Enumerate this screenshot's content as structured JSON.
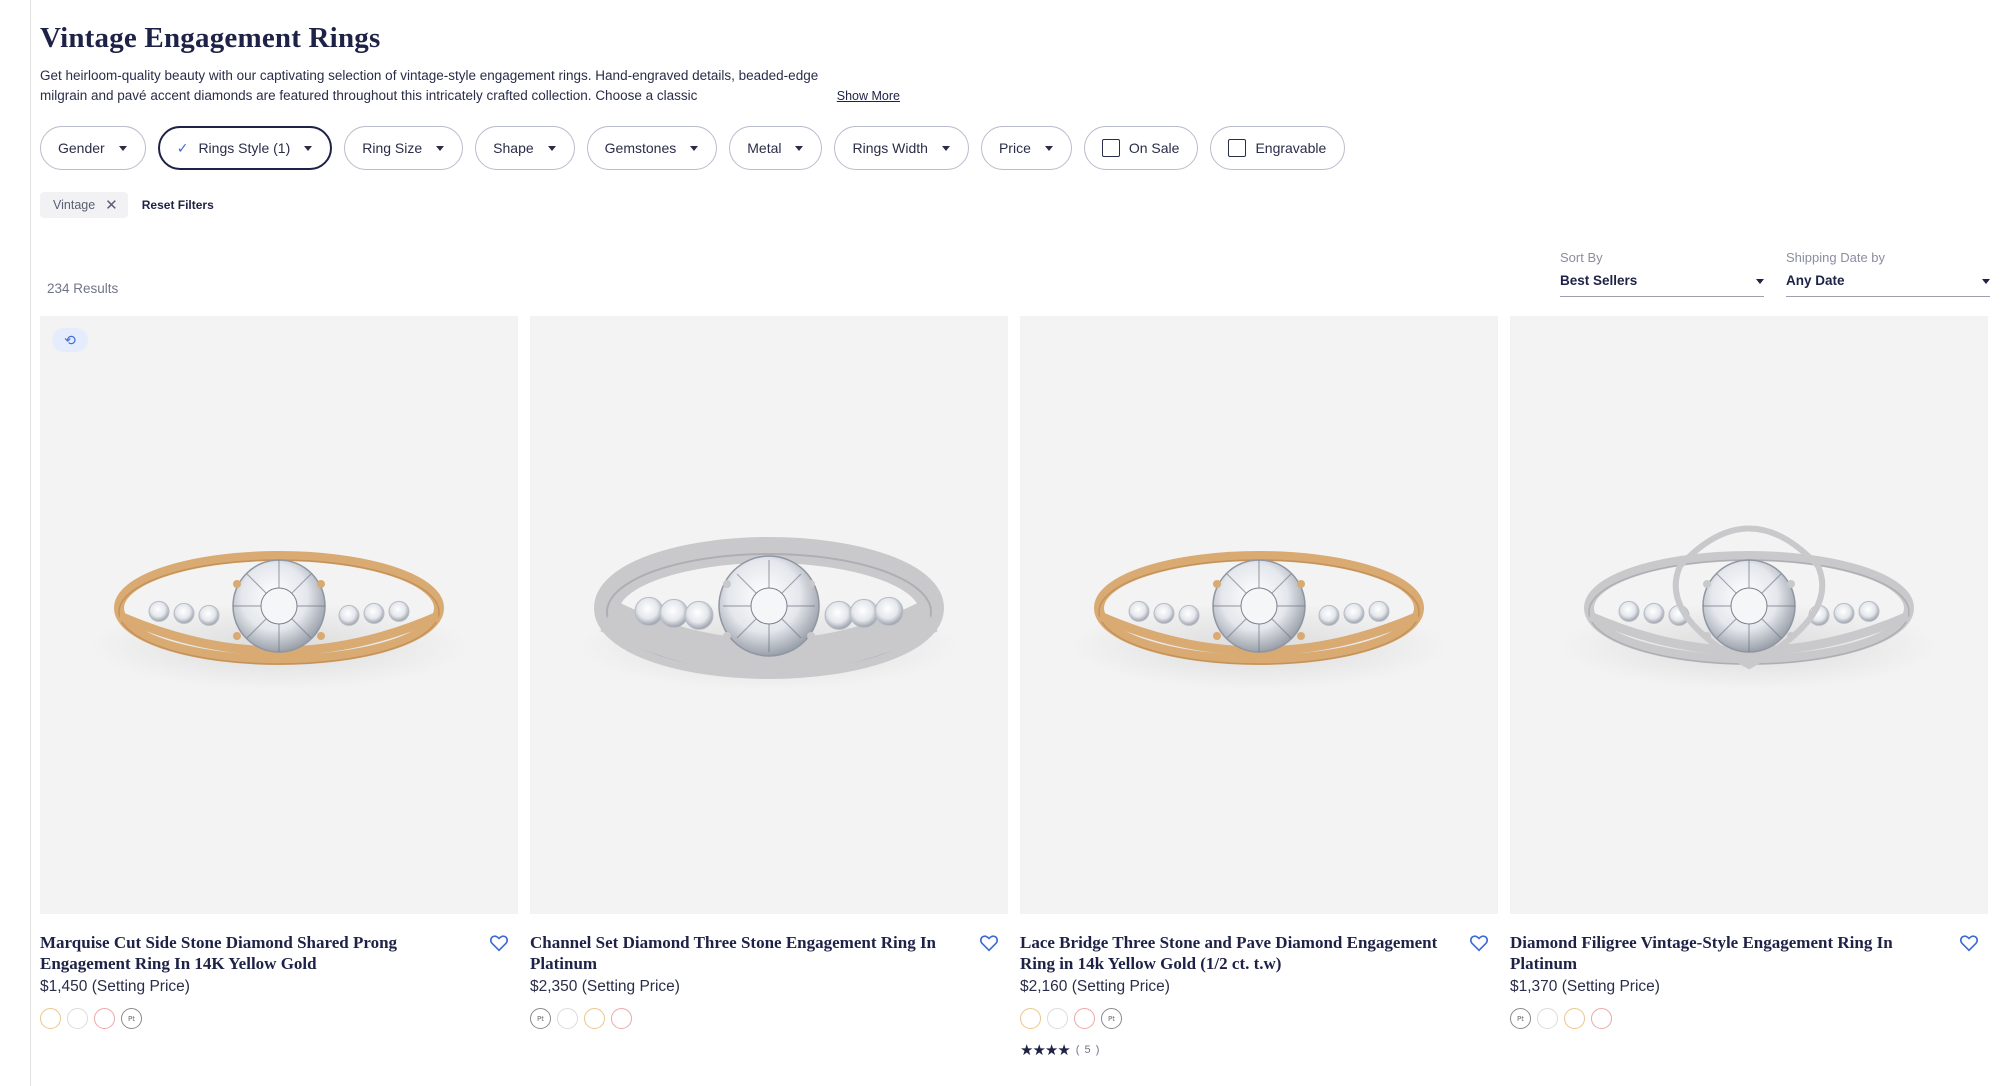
{
  "page": {
    "title": "Vintage Engagement Rings",
    "description": "Get heirloom-quality beauty with our captivating selection of vintage-style engagement rings. Hand-engraved details, beaded-edge milgrain and pavé accent diamonds are featured throughout this intricately crafted collection. Choose a classic",
    "show_more": "Show More"
  },
  "filters": [
    {
      "label": "Gender",
      "type": "dropdown"
    },
    {
      "label": "Rings Style (1)",
      "type": "dropdown-active"
    },
    {
      "label": "Ring Size",
      "type": "dropdown"
    },
    {
      "label": "Shape",
      "type": "dropdown"
    },
    {
      "label": "Gemstones",
      "type": "dropdown"
    },
    {
      "label": "Metal",
      "type": "dropdown"
    },
    {
      "label": "Rings Width",
      "type": "dropdown"
    },
    {
      "label": "Price",
      "type": "dropdown"
    },
    {
      "label": "On Sale",
      "type": "checkbox"
    },
    {
      "label": "Engravable",
      "type": "checkbox"
    }
  ],
  "applied": {
    "chip": "Vintage",
    "reset": "Reset Filters"
  },
  "results": "234 Results",
  "sort": {
    "label": "Sort By",
    "value": "Best Sellers"
  },
  "shipping": {
    "label": "Shipping Date by",
    "value": "Any Date"
  },
  "products": [
    {
      "name": "Marquise Cut Side Stone Diamond Shared Prong Engagement Ring In 14K Yellow Gold",
      "price": "$1,450 (Setting Price)",
      "metal": "yellow",
      "swatches": [
        "yellow",
        "white",
        "rose",
        "plat"
      ],
      "badge": true
    },
    {
      "name": "Channel Set Diamond Three Stone Engagement Ring In Platinum",
      "price": "$2,350 (Setting Price)",
      "metal": "platinum",
      "swatches": [
        "plat",
        "white",
        "yellow",
        "rose"
      ],
      "badge": false
    },
    {
      "name": "Lace Bridge Three Stone and Pave Diamond Engagement Ring in 14k Yellow Gold (1/2 ct. t.w)",
      "price": "$2,160 (Setting Price)",
      "metal": "yellow",
      "swatches": [
        "yellow",
        "white",
        "rose",
        "plat"
      ],
      "rating": {
        "stars": "★★★★",
        "count": "( 5 )"
      },
      "badge": false
    },
    {
      "name": "Diamond Filigree Vintage-Style Engagement Ring In Platinum",
      "price": "$1,370 (Setting Price)",
      "metal": "platinum",
      "swatches": [
        "plat",
        "white",
        "yellow",
        "rose"
      ],
      "badge": false
    }
  ],
  "swatch_glyph": "Pt",
  "colors": {
    "navy": "#1e2246",
    "accent": "#3d6bd6",
    "yellow_gold": "#d9aa72",
    "platinum": "#c9c9cc"
  }
}
